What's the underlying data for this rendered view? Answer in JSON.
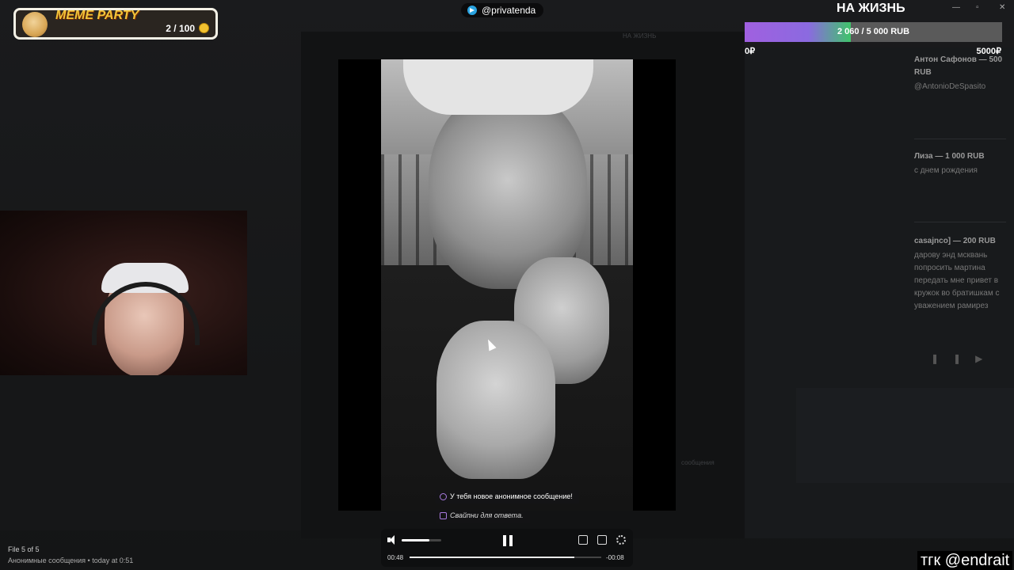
{
  "meme_party": {
    "title": "MEME PARTY",
    "count": "2 / 100"
  },
  "telegram": {
    "handle": "@privatenda"
  },
  "goal": {
    "title": "НА ЖИЗНЬ",
    "progress_text": "2 060 / 5 000 RUB",
    "current": 2060,
    "target": 5000,
    "min_label": "0₽",
    "max_label": "5000₽",
    "fill_color": "#a060e0"
  },
  "donations": [
    {
      "name": "Антон Сафонов — 500 RUB",
      "message": "@AntonioDeSpasito"
    },
    {
      "name": "Лиза — 1 000 RUB",
      "message": "с днем рождения"
    },
    {
      "name": "casajnco] — 200 RUB",
      "message": "дарову энд мсквань попросить мартина передать мне привет в кружок во братишкам с уважением рамирез"
    }
  ],
  "overlay": {
    "notification": "У тебя новое анонимное сообщение!",
    "hint": "Свайпни для ответа."
  },
  "player": {
    "elapsed": "00:48",
    "remaining": "-00:08",
    "volume": 0.7,
    "progress": 0.86
  },
  "file_info": {
    "index": "File 5 of 5",
    "source": "Анонимные сообщения • today at 0:51"
  },
  "watermark": {
    "text": "тгк @endrait"
  },
  "background_text": {
    "na_zhizn_small": "НА ЖИЗНЬ",
    "messages_label": "сообщения"
  }
}
